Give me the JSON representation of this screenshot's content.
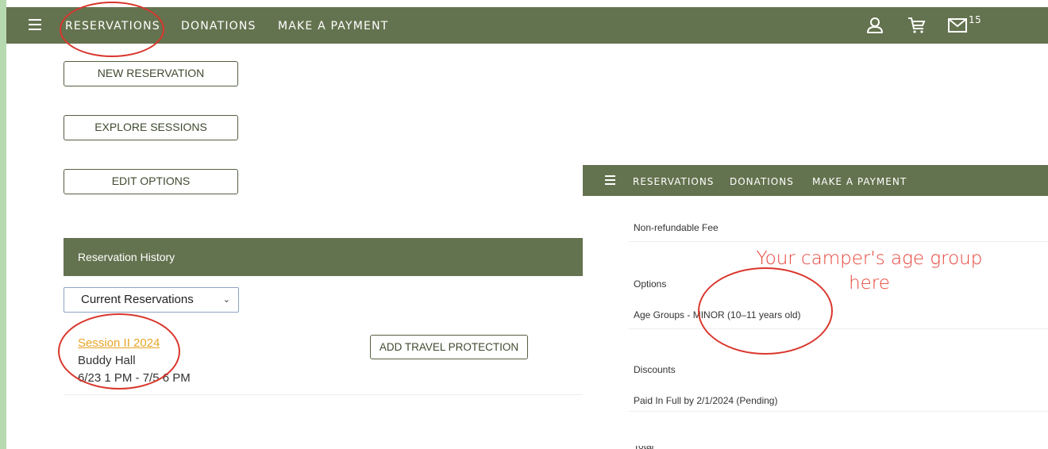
{
  "main_nav": {
    "items": [
      "RESERVATIONS",
      "DONATIONS",
      "MAKE A PAYMENT"
    ],
    "mail_count": "15",
    "icons": [
      "hamburger-menu-icon",
      "user-icon",
      "cart-icon",
      "mail-icon"
    ]
  },
  "actions": {
    "new_reservation": "NEW RESERVATION",
    "explore_sessions": "EXPLORE SESSIONS",
    "edit_options": "EDIT OPTIONS"
  },
  "history": {
    "title": "Reservation History",
    "filter_selected": "Current Reservations"
  },
  "reservation": {
    "session_link": "Session II 2024",
    "location": "Buddy Hall",
    "dates": "6/23 1 PM - 7/5 6 PM",
    "travel_button": "ADD TRAVEL PROTECTION"
  },
  "detail_panel": {
    "nav_items": [
      "RESERVATIONS",
      "DONATIONS",
      "MAKE A PAYMENT"
    ],
    "fee_label": "Non-refundable Fee",
    "options_label": "Options",
    "age_group_line": "Age Groups - MINOR (10–11 years old)",
    "discounts_label": "Discounts",
    "discount_line": "Paid In Full by 2/1/2024 (Pending)",
    "total_label": "Total"
  },
  "annotation": {
    "line1": "Your camper's age group",
    "line2": "here"
  },
  "colors": {
    "nav_green": "#64734f",
    "link_orange": "#e7a526",
    "annotation_red": "#e8443a"
  }
}
